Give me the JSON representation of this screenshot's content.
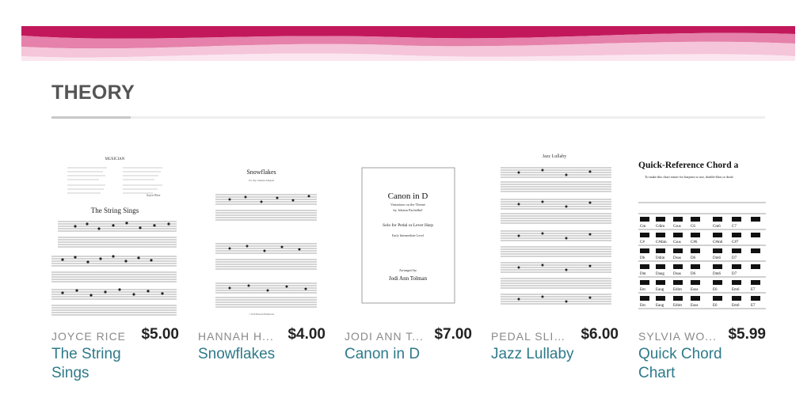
{
  "section": {
    "title": "THEORY"
  },
  "colors": {
    "banner_dark": "#c2185b",
    "banner_light": "#f3b6cf",
    "title_link": "#2e7a8a",
    "author": "#8a8a8a"
  },
  "products": [
    {
      "author": "JOYCE RICE",
      "price": "$5.00",
      "title": "The String Sings",
      "cover": {
        "heading": "MUSICIAN",
        "title": "The String Sings",
        "composer": "Joyce Rice"
      }
    },
    {
      "author": "HANNAH HAMMOND",
      "author_display": "HANNAH H...",
      "price": "$4.00",
      "title": "Snowflakes",
      "cover": {
        "title": "Snowflakes",
        "subtitle": "for my student Abigail",
        "footer": "©2016 Hannah Hammond"
      }
    },
    {
      "author": "JODI ANN TOLMAN",
      "author_display": "JODI ANN T...",
      "price": "$7.00",
      "title": "Canon in D",
      "cover": {
        "title": "Canon in D",
        "line1": "Variations on the Theme",
        "line2": "by Johann Pachelbel",
        "line3": "Solo for Pedal or Lever Harp",
        "line4": "Early Intermediate Level",
        "line5": "Arranged by",
        "line6": "Jodi Ann Tolman"
      }
    },
    {
      "author": "PEDAL SLIDE",
      "author_display": "PEDAL SLID...",
      "price": "$6.00",
      "title": "Jazz Lullaby",
      "cover": {
        "title": "Jazz Lullaby"
      }
    },
    {
      "author": "SYLVIA WOODS",
      "author_display": "SYLVIA WO...",
      "price": "$5.99",
      "title": "Quick Chord Chart",
      "cover": {
        "title": "Quick-Reference Chord a",
        "note": "To make this chart easier for harpists to use, double-flats or doub",
        "chords": [
          [
            "Cm",
            "Cdim",
            "Csus",
            "C6",
            "Cm6",
            "C7"
          ],
          [
            "C#",
            "C#dim",
            "Csus",
            "C#6",
            "C#m6",
            "C#7"
          ],
          [
            "Db",
            "Ddim",
            "Dsus",
            "D6",
            "Dm6",
            "D7"
          ],
          [
            "Dm",
            "Daug",
            "Dsus",
            "D6",
            "Dm6",
            "D7"
          ],
          [
            "Em",
            "Eaug",
            "Edim",
            "Esus",
            "E6",
            "Em6",
            "E7"
          ],
          [
            "Em",
            "Eaug",
            "Edim",
            "Esus",
            "E6",
            "Em6",
            "E7"
          ]
        ]
      }
    }
  ]
}
